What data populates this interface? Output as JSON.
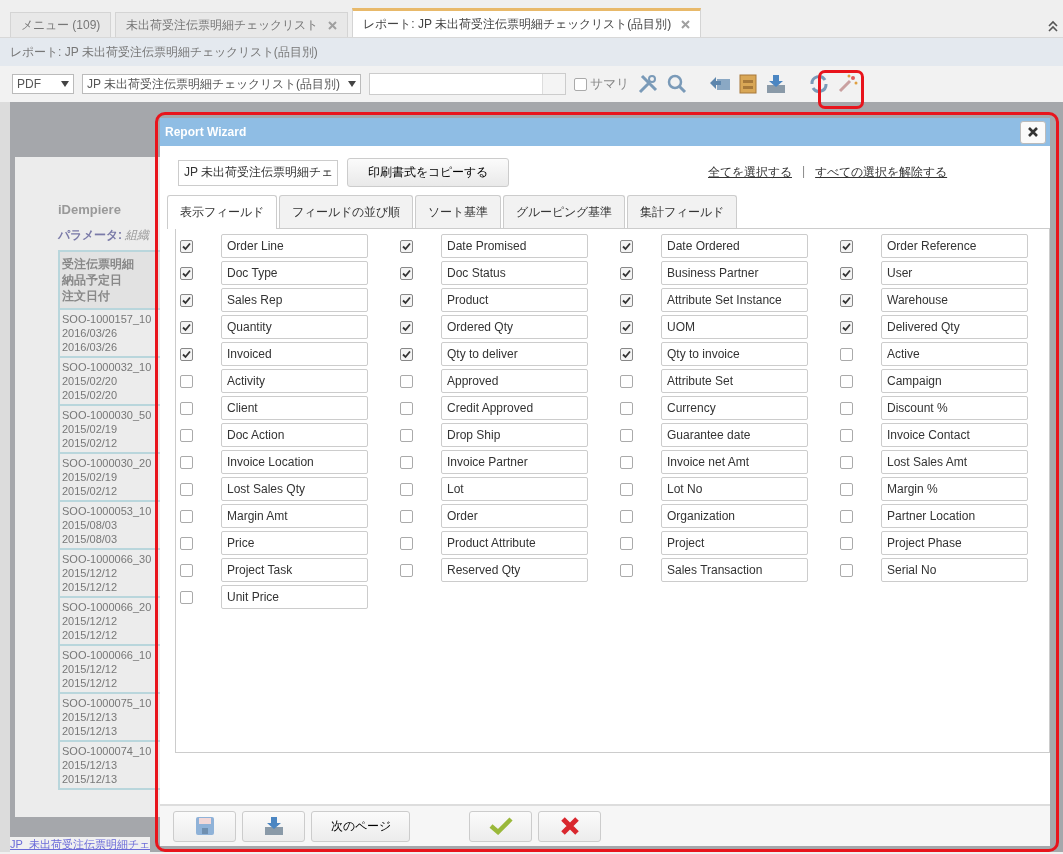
{
  "tabs": [
    {
      "label": "メニュー (109)",
      "selected": false,
      "closable": false
    },
    {
      "label": "未出荷受注伝票明細チェックリスト",
      "selected": false,
      "closable": true
    },
    {
      "label": "レポート: JP 未出荷受注伝票明細チェックリスト(品目別)",
      "selected": true,
      "closable": true
    }
  ],
  "breadcrumb": "レポート: JP 未出荷受注伝票明細チェックリスト(品目別)",
  "toolbar": {
    "format": "PDF",
    "print_format": "JP 未出荷受注伝票明細チェックリスト(品目別)",
    "summary": {
      "label": "サマリ",
      "checked": false
    }
  },
  "report": {
    "logo": "iDempiere",
    "parameter_label": "パラメータ:",
    "parameter_value": "組織",
    "header": [
      "受注伝票明細",
      "納品予定日",
      "注文日付"
    ],
    "rows": [
      [
        "SOO-1000157_10",
        "2016/03/26",
        "2016/03/26"
      ],
      [
        "SOO-1000032_10",
        "2015/02/20",
        "2015/02/20"
      ],
      [
        "SOO-1000030_50",
        "2015/02/19",
        "2015/02/12"
      ],
      [
        "SOO-1000030_20",
        "2015/02/19",
        "2015/02/12"
      ],
      [
        "SOO-1000053_10",
        "2015/08/03",
        "2015/08/03"
      ],
      [
        "SOO-1000066_30",
        "2015/12/12",
        "2015/12/12"
      ],
      [
        "SOO-1000066_20",
        "2015/12/12",
        "2015/12/12"
      ],
      [
        "SOO-1000066_10",
        "2015/12/12",
        "2015/12/12"
      ],
      [
        "SOO-1000075_10",
        "2015/12/13",
        "2015/12/13"
      ],
      [
        "SOO-1000074_10",
        "2015/12/13",
        "2015/12/13"
      ]
    ],
    "footer_link": "JP_未出荷受注伝票明細チェ"
  },
  "dialog": {
    "title": "Report Wizard",
    "name_value": "JP 未出荷受注伝票明細チェ",
    "copy_button": "印刷書式をコピーする",
    "select_all": "全てを選択する",
    "separator": "|",
    "deselect_all": "すべての選択を解除する",
    "tabs": [
      {
        "label": "表示フィールド",
        "selected": true
      },
      {
        "label": "フィールドの並び順",
        "selected": false
      },
      {
        "label": "ソート基準",
        "selected": false
      },
      {
        "label": "グルーピング基準",
        "selected": false
      },
      {
        "label": "集計フィールド",
        "selected": false
      }
    ],
    "fields": [
      {
        "label": "Order Line",
        "checked": true
      },
      {
        "label": "Date Promised",
        "checked": true
      },
      {
        "label": "Date Ordered",
        "checked": true
      },
      {
        "label": "Order Reference",
        "checked": true
      },
      {
        "label": "Doc Type",
        "checked": true
      },
      {
        "label": "Doc Status",
        "checked": true
      },
      {
        "label": "Business Partner",
        "checked": true
      },
      {
        "label": "User",
        "checked": true
      },
      {
        "label": "Sales Rep",
        "checked": true
      },
      {
        "label": "Product",
        "checked": true
      },
      {
        "label": "Attribute Set Instance",
        "checked": true
      },
      {
        "label": "Warehouse",
        "checked": true
      },
      {
        "label": "Quantity",
        "checked": true
      },
      {
        "label": "Ordered Qty",
        "checked": true
      },
      {
        "label": "UOM",
        "checked": true
      },
      {
        "label": "Delivered Qty",
        "checked": true
      },
      {
        "label": "Invoiced",
        "checked": true
      },
      {
        "label": "Qty to deliver",
        "checked": true
      },
      {
        "label": "Qty to invoice",
        "checked": true
      },
      {
        "label": "Active",
        "checked": false
      },
      {
        "label": "Activity",
        "checked": false
      },
      {
        "label": "Approved",
        "checked": false
      },
      {
        "label": "Attribute Set",
        "checked": false
      },
      {
        "label": "Campaign",
        "checked": false
      },
      {
        "label": "Client",
        "checked": false
      },
      {
        "label": "Credit Approved",
        "checked": false
      },
      {
        "label": "Currency",
        "checked": false
      },
      {
        "label": "Discount %",
        "checked": false
      },
      {
        "label": "Doc Action",
        "checked": false
      },
      {
        "label": "Drop Ship",
        "checked": false
      },
      {
        "label": "Guarantee date",
        "checked": false
      },
      {
        "label": "Invoice Contact",
        "checked": false
      },
      {
        "label": "Invoice Location",
        "checked": false
      },
      {
        "label": "Invoice Partner",
        "checked": false
      },
      {
        "label": "Invoice net Amt",
        "checked": false
      },
      {
        "label": "Lost Sales Amt",
        "checked": false
      },
      {
        "label": "Lost Sales Qty",
        "checked": false
      },
      {
        "label": "Lot",
        "checked": false
      },
      {
        "label": "Lot No",
        "checked": false
      },
      {
        "label": "Margin %",
        "checked": false
      },
      {
        "label": "Margin Amt",
        "checked": false
      },
      {
        "label": "Order",
        "checked": false
      },
      {
        "label": "Organization",
        "checked": false
      },
      {
        "label": "Partner Location",
        "checked": false
      },
      {
        "label": "Price",
        "checked": false
      },
      {
        "label": "Product Attribute",
        "checked": false
      },
      {
        "label": "Project",
        "checked": false
      },
      {
        "label": "Project Phase",
        "checked": false
      },
      {
        "label": "Project Task",
        "checked": false
      },
      {
        "label": "Reserved Qty",
        "checked": false
      },
      {
        "label": "Sales Transaction",
        "checked": false
      },
      {
        "label": "Serial No",
        "checked": false
      },
      {
        "label": "Unit Price",
        "checked": false
      }
    ],
    "next_button": "次のページ"
  }
}
